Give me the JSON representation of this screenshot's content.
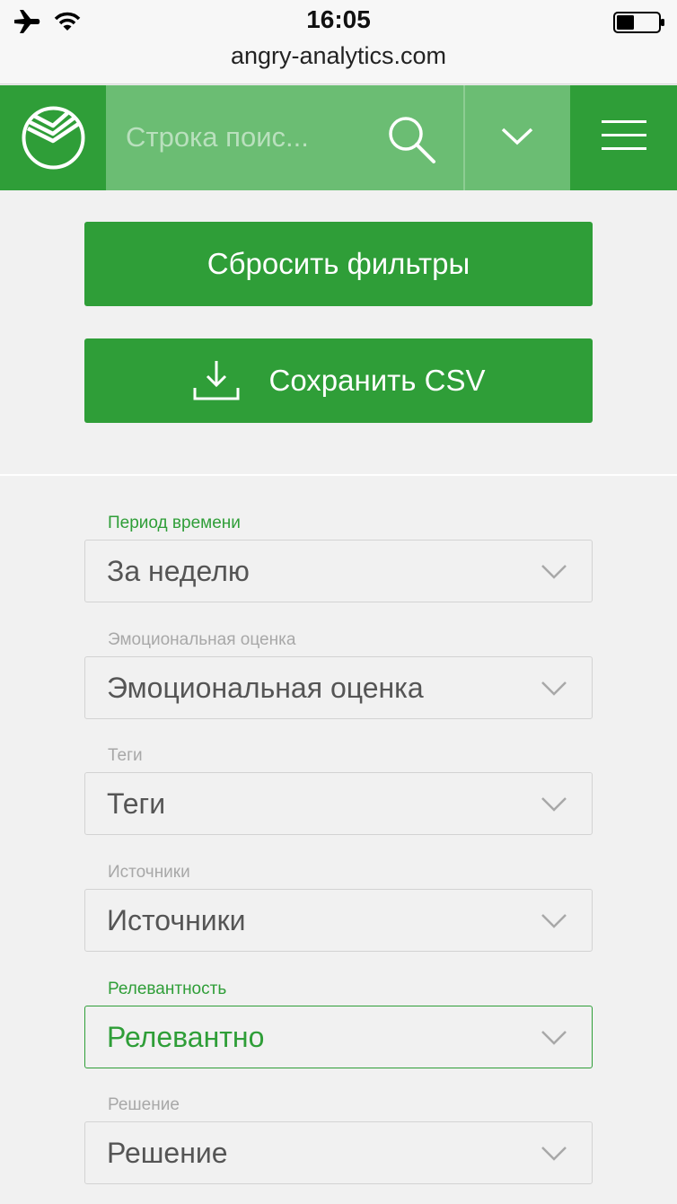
{
  "status_bar": {
    "time": "16:05",
    "url": "angry-analytics.com",
    "icons": [
      "airplane-icon",
      "wifi-icon",
      "battery-icon"
    ]
  },
  "header": {
    "search_placeholder": "Строка поис...",
    "logo": "sberbank-logo",
    "icons": [
      "search-icon",
      "chevron-down-icon",
      "hamburger-menu-icon"
    ],
    "colors": {
      "primary_green": "#2f9e38",
      "light_green": "#6bbd73"
    }
  },
  "actions": {
    "reset_label": "Сбросить фильтры",
    "save_csv_label": "Сохранить CSV",
    "save_csv_icon": "download-icon"
  },
  "filters": [
    {
      "label": "Период времени",
      "value": "За неделю",
      "highlighted": true
    },
    {
      "label": "Эмоциональная оценка",
      "value": "Эмоциональная оценка",
      "highlighted": false
    },
    {
      "label": "Теги",
      "value": "Теги",
      "highlighted": false
    },
    {
      "label": "Источники",
      "value": "Источники",
      "highlighted": false
    },
    {
      "label": "Релевантность",
      "value": "Релевантно",
      "highlighted": true
    },
    {
      "label": "Решение",
      "value": "Решение",
      "highlighted": false
    }
  ]
}
